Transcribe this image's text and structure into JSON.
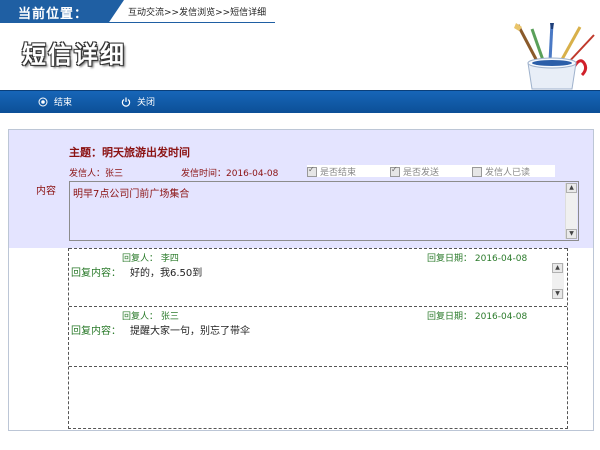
{
  "header": {
    "location_label": "当前位置：",
    "breadcrumb": "互动交流>>发信浏览>>短信详细",
    "page_title": "短信详细"
  },
  "toolbar": {
    "end_label": "结束",
    "close_label": "关闭"
  },
  "message": {
    "side_label": "内容",
    "subject": "主题：明天旅游出发时间",
    "sender": "发信人：张三",
    "send_time": "发信时间：2016-04-08",
    "checks": [
      {
        "label": "是否结束",
        "checked": true
      },
      {
        "label": "是否发送",
        "checked": true
      },
      {
        "label": "发信人已读",
        "checked": false
      }
    ],
    "content": "明早7点公司门前广场集合"
  },
  "replies": [
    {
      "replier": "回复人：  李四",
      "date": "回复日期：  2016-04-08",
      "label": "回复内容：",
      "text": "好的，我6.50到"
    },
    {
      "replier": "回复人：  张三",
      "date": "回复日期：  2016-04-08",
      "label": "回复内容：",
      "text": "提醒大家一句，别忘了带伞"
    }
  ]
}
